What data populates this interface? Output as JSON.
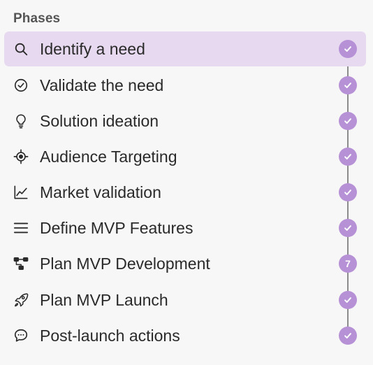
{
  "panel": {
    "heading": "Phases"
  },
  "colors": {
    "active_background": "#e7daf0",
    "status_fill": "#b791d6",
    "connector": "#8c8c8c"
  },
  "phases": [
    {
      "label": "Identify a need",
      "icon": "search-icon",
      "status": "complete",
      "active": true
    },
    {
      "label": "Validate the need",
      "icon": "check-circle-icon",
      "status": "complete",
      "active": false
    },
    {
      "label": "Solution ideation",
      "icon": "lightbulb-icon",
      "status": "complete",
      "active": false
    },
    {
      "label": "Audience Targeting",
      "icon": "target-icon",
      "status": "complete",
      "active": false
    },
    {
      "label": "Market validation",
      "icon": "line-chart-icon",
      "status": "complete",
      "active": false
    },
    {
      "label": "Define MVP Features",
      "icon": "list-icon",
      "status": "complete",
      "active": false
    },
    {
      "label": "Plan MVP Development",
      "icon": "hierarchy-icon",
      "status": "pending",
      "status_text": "7",
      "active": false
    },
    {
      "label": "Plan MVP Launch",
      "icon": "rocket-icon",
      "status": "complete",
      "active": false
    },
    {
      "label": "Post-launch actions",
      "icon": "chat-bubble-icon",
      "status": "complete",
      "active": false
    }
  ]
}
